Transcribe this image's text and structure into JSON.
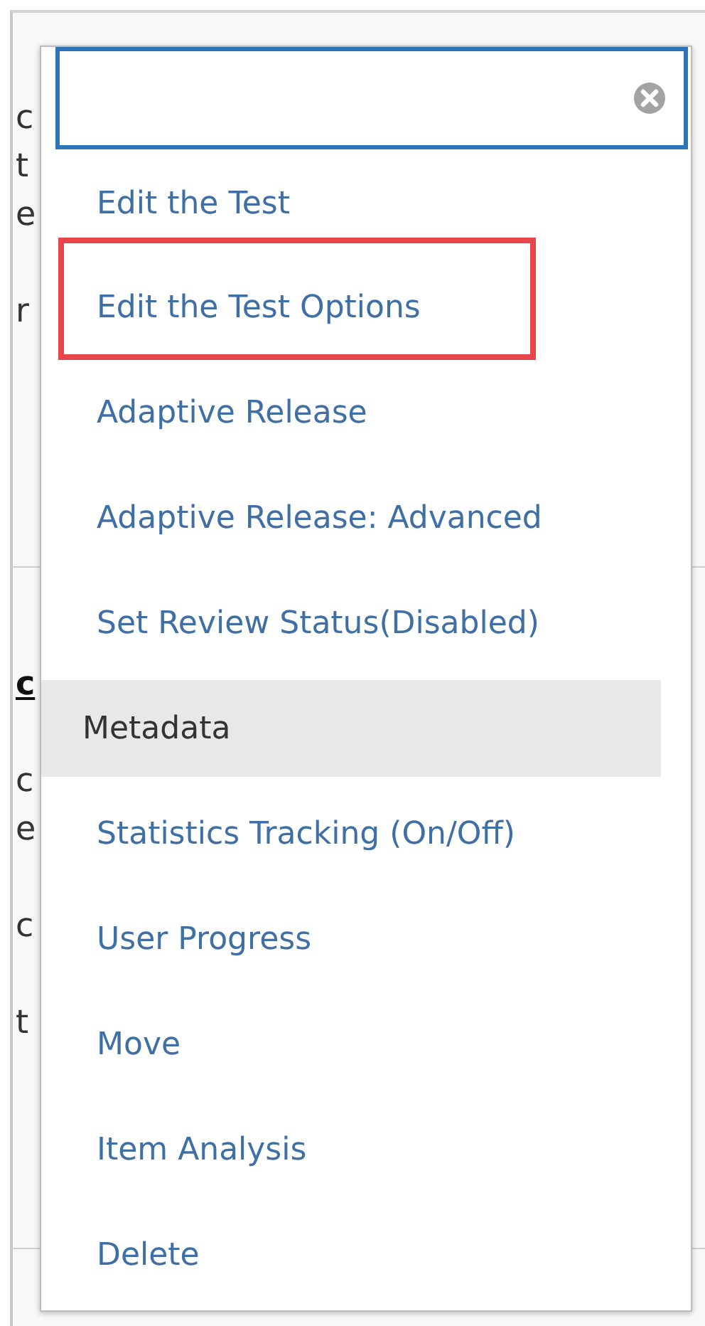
{
  "background": {
    "sections": [
      {
        "lines": [
          {
            "left": "c"
          },
          {
            "left": "t"
          },
          {
            "left": "e"
          },
          {
            "left": "r"
          }
        ]
      },
      {
        "lines": [
          {
            "left": "c",
            "kind": "heading"
          },
          {
            "left": "c"
          },
          {
            "left": "e"
          },
          {
            "left": "c"
          },
          {
            "left": "t"
          }
        ]
      }
    ]
  },
  "menu": {
    "search": {
      "clear_button": true
    },
    "items": [
      {
        "label": "Edit the Test",
        "selected": false,
        "marked": false
      },
      {
        "label": "Edit the Test Options",
        "selected": false,
        "marked": true
      },
      {
        "label": "Adaptive Release",
        "selected": false,
        "marked": false
      },
      {
        "label": "Adaptive Release: Advanced",
        "selected": false,
        "marked": false
      },
      {
        "label": "Set Review Status(Disabled)",
        "selected": false,
        "marked": false
      },
      {
        "label": "Metadata",
        "selected": true,
        "marked": false
      },
      {
        "label": "Statistics Tracking (On/Off)",
        "selected": false,
        "marked": false
      },
      {
        "label": "User Progress",
        "selected": false,
        "marked": false
      },
      {
        "label": "Move",
        "selected": false,
        "marked": false
      },
      {
        "label": "Item Analysis",
        "selected": false,
        "marked": false
      },
      {
        "label": "Delete",
        "selected": false,
        "marked": false
      }
    ]
  }
}
